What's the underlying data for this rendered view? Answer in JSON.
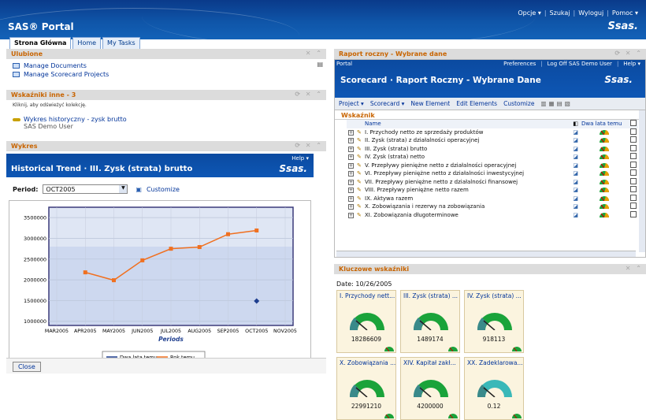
{
  "header": {
    "title": "SAS® Portal",
    "logo": "Ssas.",
    "menu": [
      "Opcje ▾",
      "Szukaj",
      "Wyloguj",
      "Pomoc ▾"
    ],
    "tabs": [
      "Strona Główna",
      "Home",
      "My Tasks"
    ]
  },
  "left": {
    "ulubione": {
      "title": "Ulubione",
      "items": [
        "Manage Documents",
        "Manage Scorecard Projects"
      ]
    },
    "wskazniki": {
      "title": "Wskaźniki inne - 3",
      "hint": "Kliknij, aby odświeżyć kolekcję.",
      "item": "Wykres historyczny - zysk brutto",
      "user": "SAS Demo User"
    },
    "wykres": {
      "title": "Wykres",
      "help": "Help ▾",
      "banner": "Historical Trend  ·  III. Zysk (strata) brutto",
      "period_label": "Period:",
      "period_value": "OCT2005",
      "customize": "Customize",
      "close": "Close"
    }
  },
  "chart_data": {
    "type": "line",
    "xlabel": "Periods",
    "ylabel": "",
    "categories": [
      "MAR2005",
      "APR2005",
      "MAY2005",
      "JUN2005",
      "JUL2005",
      "AUG2005",
      "SEP2005",
      "OCT2005",
      "NOV2005"
    ],
    "ylim": [
      900000,
      3750000
    ],
    "yticks": [
      "1000000",
      "1500000",
      "2000000",
      "2500000",
      "3000000",
      "3500000"
    ],
    "series": [
      {
        "name": "Dwa lata temu",
        "color": "#1f3f8f",
        "values": [
          null,
          null,
          null,
          null,
          null,
          null,
          null,
          1489174,
          null
        ]
      },
      {
        "name": "Rok temu",
        "color": "#f07020",
        "values": [
          null,
          2180000,
          1990000,
          2470000,
          2750000,
          2790000,
          3100000,
          3190000,
          null
        ]
      }
    ]
  },
  "right": {
    "raport": {
      "title": "Raport roczny - Wybrane dane",
      "breadcrumb": "Portal",
      "links": [
        "Preferences",
        "Log Off SAS Demo User",
        "Help ▾"
      ],
      "banner": "Scorecard · Raport Roczny - Wybrane Dane",
      "logo": "Ssas.",
      "toolbar": [
        "Project ▾",
        "Scorecard ▾",
        "New Element",
        "Edit Elements",
        "Customize"
      ],
      "section": "Wskaźnik",
      "col_name": "Name",
      "col_metric": "Dwa lata temu",
      "rows": [
        "I. Przychody netto ze sprzedaży produktów",
        "II. Zysk (strata) z działalności operacyjnej",
        "III. Zysk (strata) brutto",
        "IV. Zysk (strata) netto",
        "V. Przepływy pieniężne netto z działalności operacyjnej",
        "VI. Przepływy pieniężne netto z działalności inwestycyjnej",
        "VII. Przepływy pieniężne netto z działalności finansowej",
        "VIII. Przepływy pieniężne netto razem",
        "IX. Aktywa razem",
        "X. Zobowiązania i rezerwy na zobowiązania",
        "XI. Zobowiązania długoterminowe"
      ]
    },
    "kluczowe": {
      "title": "Kluczowe wskaźniki",
      "date": "Date: 10/26/2005",
      "tiles": [
        {
          "title": "I. Przychody nett...",
          "value": "18286609",
          "color": "#1aa33a"
        },
        {
          "title": "III. Zysk (strata) ...",
          "value": "1489174",
          "color": "#1aa33a"
        },
        {
          "title": "IV. Zysk (strata) ...",
          "value": "918113",
          "color": "#1aa33a"
        },
        {
          "title": "X. Zobowiązania ...",
          "value": "22991210",
          "color": "#1aa33a"
        },
        {
          "title": "XIV. Kapitał zakł...",
          "value": "4200000",
          "color": "#1aa33a"
        },
        {
          "title": "XX. Zadeklarowa...",
          "value": "0.12",
          "color": "#3ab8b8"
        }
      ]
    }
  }
}
